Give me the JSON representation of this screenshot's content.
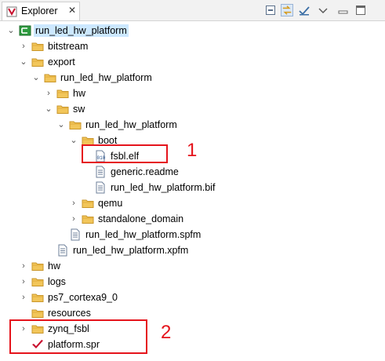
{
  "tab": {
    "title": "Explorer",
    "close": "✕"
  },
  "toolbar": [
    "collapse-all-button",
    "link-with-editor-button",
    "filters-button",
    "view-menu-button"
  ],
  "tree": [
    {
      "id": "root",
      "label": "run_led_hw_platform",
      "icon": "platform-project-icon",
      "depth": 0,
      "state": "open",
      "selected": true
    },
    {
      "id": "bitstream",
      "label": "bitstream",
      "icon": "folder-icon",
      "depth": 1,
      "state": "closed"
    },
    {
      "id": "export",
      "label": "export",
      "icon": "folder-icon",
      "depth": 1,
      "state": "open"
    },
    {
      "id": "export-platform",
      "label": "run_led_hw_platform",
      "icon": "folder-icon",
      "depth": 2,
      "state": "open"
    },
    {
      "id": "hw-inner",
      "label": "hw",
      "icon": "folder-icon",
      "depth": 3,
      "state": "closed"
    },
    {
      "id": "sw",
      "label": "sw",
      "icon": "folder-icon",
      "depth": 3,
      "state": "open"
    },
    {
      "id": "sw-platform",
      "label": "run_led_hw_platform",
      "icon": "folder-icon",
      "depth": 4,
      "state": "open"
    },
    {
      "id": "boot",
      "label": "boot",
      "icon": "folder-icon",
      "depth": 5,
      "state": "open"
    },
    {
      "id": "fsbl-elf",
      "label": "fsbl.elf",
      "icon": "binary-file-icon",
      "depth": 6,
      "state": "leaf"
    },
    {
      "id": "generic-readme",
      "label": "generic.readme",
      "icon": "text-file-icon",
      "depth": 6,
      "state": "leaf"
    },
    {
      "id": "platform-bif",
      "label": "run_led_hw_platform.bif",
      "icon": "text-file-icon",
      "depth": 6,
      "state": "leaf"
    },
    {
      "id": "qemu",
      "label": "qemu",
      "icon": "folder-icon",
      "depth": 5,
      "state": "closed"
    },
    {
      "id": "standalone",
      "label": "standalone_domain",
      "icon": "folder-icon",
      "depth": 5,
      "state": "closed"
    },
    {
      "id": "spfm",
      "label": "run_led_hw_platform.spfm",
      "icon": "text-file-icon",
      "depth": 4,
      "state": "leaf"
    },
    {
      "id": "xpfm",
      "label": "run_led_hw_platform.xpfm",
      "icon": "text-file-icon",
      "depth": 3,
      "state": "leaf"
    },
    {
      "id": "hw",
      "label": "hw",
      "icon": "folder-icon",
      "depth": 1,
      "state": "closed"
    },
    {
      "id": "logs",
      "label": "logs",
      "icon": "folder-icon",
      "depth": 1,
      "state": "closed"
    },
    {
      "id": "ps7",
      "label": "ps7_cortexa9_0",
      "icon": "folder-icon",
      "depth": 1,
      "state": "closed"
    },
    {
      "id": "resources",
      "label": "resources",
      "icon": "folder-icon",
      "depth": 1,
      "state": "leaf"
    },
    {
      "id": "zynq-fsbl",
      "label": "zynq_fsbl",
      "icon": "folder-icon",
      "depth": 1,
      "state": "closed"
    },
    {
      "id": "platform-spr",
      "label": "platform.spr",
      "icon": "spr-file-icon",
      "depth": 1,
      "state": "leaf"
    }
  ],
  "annotations": [
    {
      "number": "1",
      "target": "fsbl.elf"
    },
    {
      "number": "2",
      "target": "zynq_fsbl / platform.spr"
    }
  ],
  "colors": {
    "highlight": "#e5141c",
    "selection": "#cce8ff",
    "folder": "#e8b84a",
    "platform": "#2e9b3f"
  }
}
